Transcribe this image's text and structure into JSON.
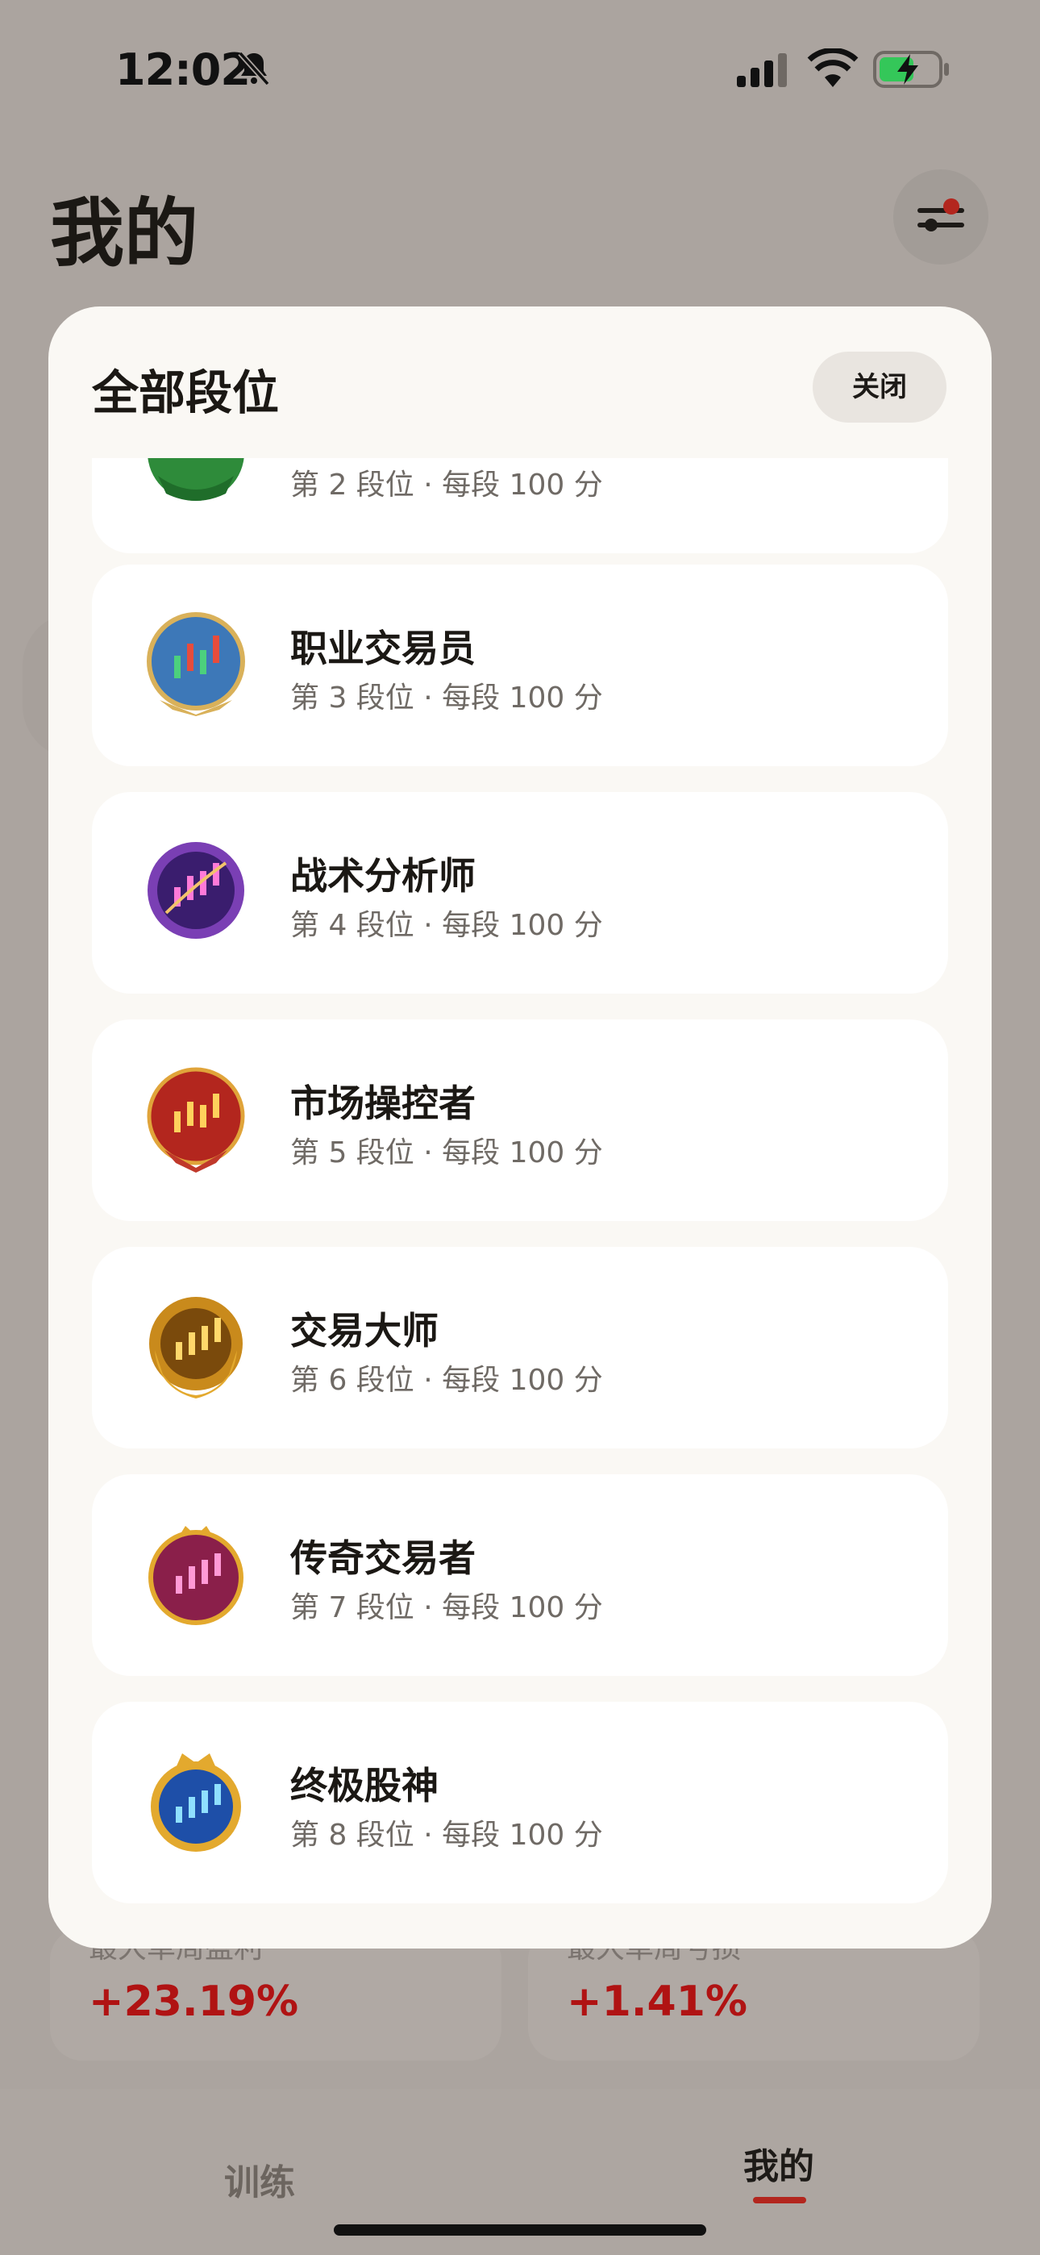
{
  "status_bar": {
    "time": "12:02"
  },
  "header": {
    "title": "我的"
  },
  "modal": {
    "title": "全部段位",
    "close_label": "关闭",
    "ranks": [
      {
        "name": "",
        "meta": "第 2 段位 · 每段 100 分",
        "color": "#2e8b3a"
      },
      {
        "name": "职业交易员",
        "meta": "第 3 段位 · 每段 100 分",
        "color": "#3d78b8"
      },
      {
        "name": "战术分析师",
        "meta": "第 4 段位 · 每段 100 分",
        "color": "#7a3fb4"
      },
      {
        "name": "市场操控者",
        "meta": "第 5 段位 · 每段 100 分",
        "color": "#b3261e"
      },
      {
        "name": "交易大师",
        "meta": "第 6 段位 · 每段 100 分",
        "color": "#c98a1c"
      },
      {
        "name": "传奇交易者",
        "meta": "第 7 段位 · 每段 100 分",
        "color": "#8a1f4a"
      },
      {
        "name": "终极股神",
        "meta": "第 8 段位 · 每段 100 分",
        "color": "#1e4fa8"
      }
    ]
  },
  "stats": [
    {
      "label": "最大单周盈利",
      "value": "+23.19%"
    },
    {
      "label": "最大单周亏损",
      "value": "+1.41%"
    }
  ],
  "tabs": [
    {
      "label": "训练"
    },
    {
      "label": "我的"
    }
  ]
}
